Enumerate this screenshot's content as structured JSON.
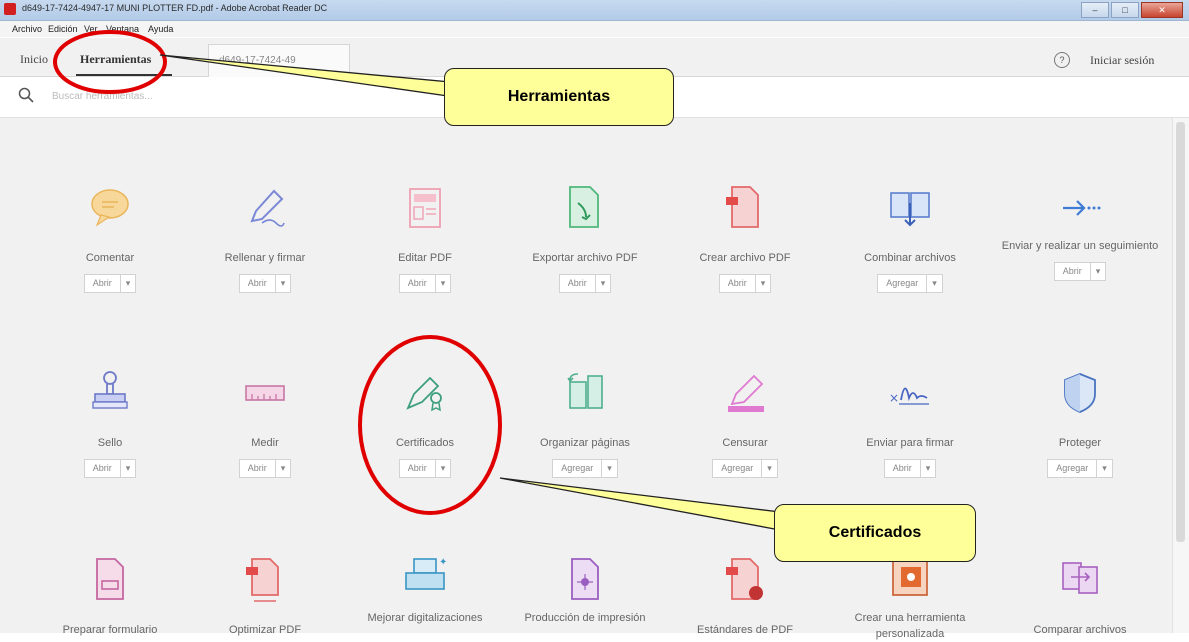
{
  "window": {
    "title": "d649-17-7424-4947-17 MUNI PLOTTER FD.pdf - Adobe Acrobat Reader DC"
  },
  "menu": [
    "Archivo",
    "Edición",
    "Ver",
    "Ventana",
    "Ayuda"
  ],
  "tabs": {
    "home": "Inicio",
    "tools": "Herramientas",
    "doc": "d649-17-7424-49"
  },
  "header": {
    "help": "?",
    "login": "Iniciar sesión"
  },
  "search": {
    "placeholder": "Buscar herramientas..."
  },
  "tools": [
    {
      "label": "Comentar",
      "action": "Abrir"
    },
    {
      "label": "Rellenar y firmar",
      "action": "Abrir"
    },
    {
      "label": "Editar PDF",
      "action": "Abrir"
    },
    {
      "label": "Exportar archivo PDF",
      "action": "Abrir"
    },
    {
      "label": "Crear archivo PDF",
      "action": "Abrir"
    },
    {
      "label": "Combinar archivos",
      "action": "Agregar"
    },
    {
      "label": "Enviar y realizar un seguimiento",
      "action": "Abrir"
    },
    {
      "label": "Sello",
      "action": "Abrir"
    },
    {
      "label": "Medir",
      "action": "Abrir"
    },
    {
      "label": "Certificados",
      "action": "Abrir"
    },
    {
      "label": "Organizar páginas",
      "action": "Agregar"
    },
    {
      "label": "Censurar",
      "action": "Agregar"
    },
    {
      "label": "Enviar para firmar",
      "action": "Abrir"
    },
    {
      "label": "Proteger",
      "action": "Agregar"
    },
    {
      "label": "Preparar formulario"
    },
    {
      "label": "Optimizar PDF"
    },
    {
      "label": "Mejorar digitalizaciones"
    },
    {
      "label": "Producción de impresión"
    },
    {
      "label": "Estándares de PDF"
    },
    {
      "label": "Crear una herramienta personalizada"
    },
    {
      "label": "Comparar archivos"
    }
  ],
  "annotations": {
    "herramientas": "Herramientas",
    "certificados": "Certificados"
  },
  "colors": {
    "annotation_fill": "#ffff99",
    "annotation_circle": "#e00000"
  }
}
